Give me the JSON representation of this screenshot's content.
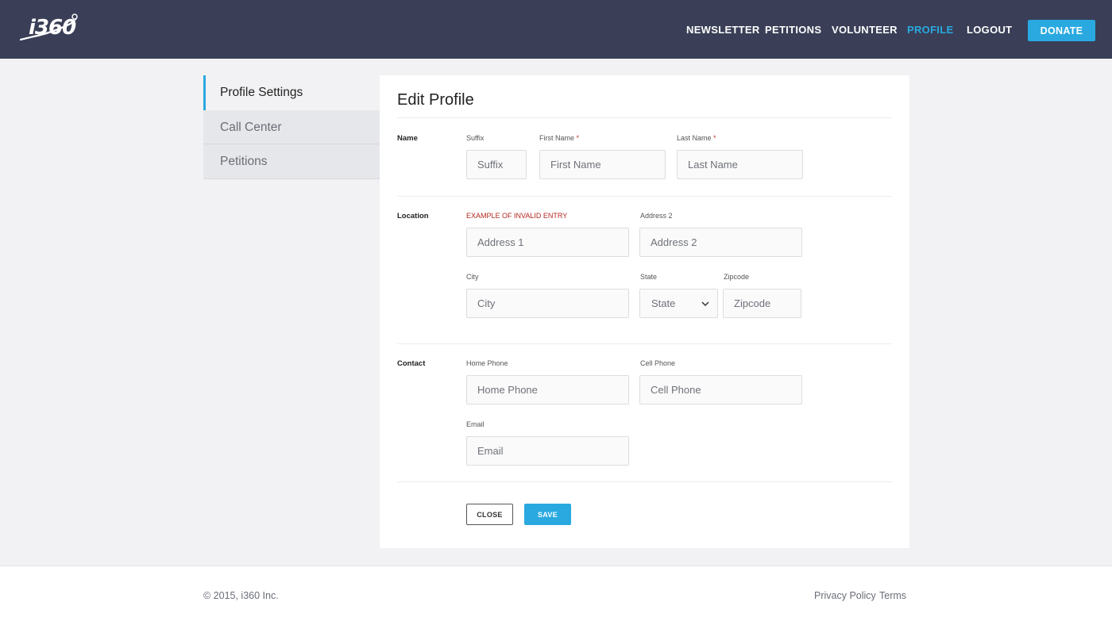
{
  "brand": {
    "logo_text": "i360",
    "accent": "#29a9e0",
    "header_bg": "#3a3f57"
  },
  "nav": {
    "items": [
      {
        "label": "NEWSLETTER"
      },
      {
        "label": "PETITIONS"
      },
      {
        "label": "VOLUNTEER"
      },
      {
        "label": "PROFILE",
        "active": true
      },
      {
        "label": "LOGOUT"
      }
    ],
    "donate_label": "DONATE"
  },
  "sidebar": {
    "items": [
      {
        "label": "Profile Settings",
        "active": true
      },
      {
        "label": "Call Center"
      },
      {
        "label": "Petitions"
      }
    ]
  },
  "form": {
    "title": "Edit Profile",
    "name": {
      "section_label": "Name",
      "suffix": {
        "label": "Suffix",
        "placeholder": "Suffix"
      },
      "first_name": {
        "label": "First Name",
        "required_mark": "*",
        "placeholder": "First Name"
      },
      "last_name": {
        "label": "Last Name",
        "required_mark": "*",
        "placeholder": "Last Name"
      }
    },
    "location": {
      "section_label": "Location",
      "address1": {
        "label": "EXAMPLE OF INVALID ENTRY",
        "placeholder": "Address 1"
      },
      "address2": {
        "label": "Address 2",
        "placeholder": "Address 2"
      },
      "city": {
        "label": "City",
        "placeholder": "City"
      },
      "state": {
        "label": "State",
        "selected": "State"
      },
      "zipcode": {
        "label": "Zipcode",
        "placeholder": "Zipcode"
      }
    },
    "contact": {
      "section_label": "Contact",
      "home_phone": {
        "label": "Home Phone",
        "placeholder": "Home Phone"
      },
      "cell_phone": {
        "label": "Cell Phone",
        "placeholder": "Cell Phone"
      },
      "email": {
        "label": "Email",
        "placeholder": "Email"
      }
    },
    "close_label": "CLOSE",
    "save_label": "SAVE"
  },
  "footer": {
    "copyright": "© 2015, i360 Inc.",
    "privacy_label": "Privacy Policy",
    "terms_label": "Terms"
  }
}
